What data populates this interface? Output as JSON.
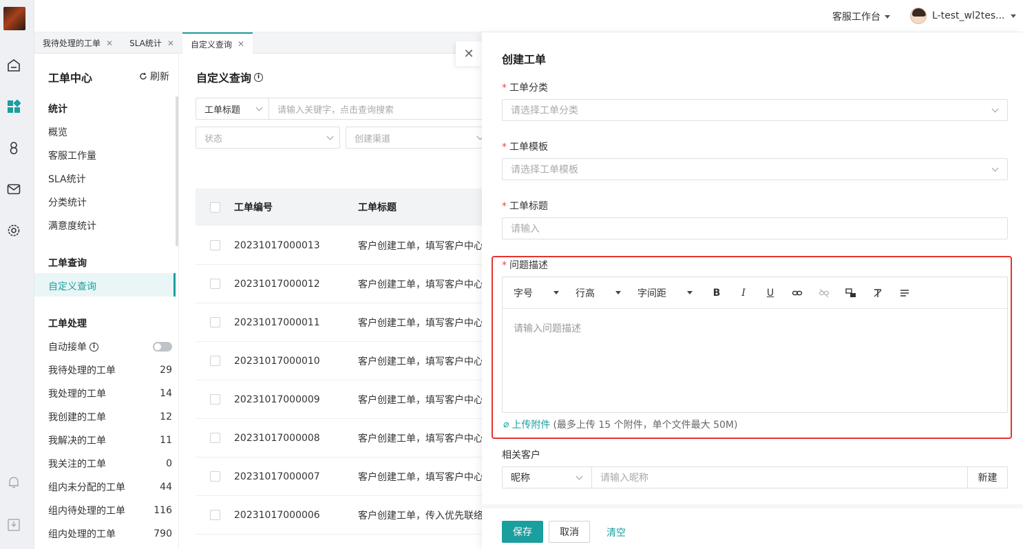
{
  "topbar": {
    "workspace": "客服工作台",
    "username": "L-test_wl2tes..."
  },
  "tabs": [
    {
      "label": "我待处理的工单",
      "active": false
    },
    {
      "label": "SLA统计",
      "active": false
    },
    {
      "label": "自定义查询",
      "active": true
    }
  ],
  "sidenav": {
    "title": "工单中心",
    "refresh": "刷新",
    "sections": {
      "stats": {
        "label": "统计",
        "items": [
          "概览",
          "客服工作量",
          "SLA统计",
          "分类统计",
          "满意度统计"
        ]
      },
      "query": {
        "label": "工单查询",
        "items": [
          "自定义查询"
        ]
      },
      "process": {
        "label": "工单处理",
        "auto_accept": "自动接单",
        "items": [
          {
            "label": "我待处理的工单",
            "count": "29"
          },
          {
            "label": "我处理的工单",
            "count": "14"
          },
          {
            "label": "我创建的工单",
            "count": "12"
          },
          {
            "label": "我解决的工单",
            "count": "11"
          },
          {
            "label": "我关注的工单",
            "count": "0"
          },
          {
            "label": "组内未分配的工单",
            "count": "44"
          },
          {
            "label": "组内待处理的工单",
            "count": "116"
          },
          {
            "label": "组内处理的工单",
            "count": "790"
          }
        ]
      }
    }
  },
  "main": {
    "title": "自定义查询",
    "search_field": "工单标题",
    "search_placeholder": "请输入关键字，点击查询搜索",
    "filter_status": "状态",
    "filter_channel": "创建渠道",
    "columns": [
      "工单编号",
      "工单标题"
    ],
    "rows": [
      {
        "id": "20231017000013",
        "title": "客户创建工单，填写客户中心"
      },
      {
        "id": "20231017000012",
        "title": "客户创建工单，填写客户中心"
      },
      {
        "id": "20231017000011",
        "title": "客户创建工单，填写客户中心"
      },
      {
        "id": "20231017000010",
        "title": "客户创建工单，填写客户中心"
      },
      {
        "id": "20231017000009",
        "title": "客户创建工单，填写客户中心"
      },
      {
        "id": "20231017000008",
        "title": "客户创建工单，填写客户中心"
      },
      {
        "id": "20231017000007",
        "title": "客户创建工单，填写客户中心"
      },
      {
        "id": "20231017000006",
        "title": "客户创建工单，传入优先联络"
      }
    ]
  },
  "drawer": {
    "title": "创建工单",
    "category_label": "工单分类",
    "category_placeholder": "请选择工单分类",
    "template_label": "工单模板",
    "template_placeholder": "请选择工单模板",
    "subject_label": "工单标题",
    "subject_placeholder": "请输入",
    "desc_label": "问题描述",
    "toolbar": {
      "font_size": "字号",
      "line_height": "行高",
      "letter_spacing": "字间距"
    },
    "desc_placeholder": "请输入问题描述",
    "upload_link": "上传附件",
    "upload_hint": "(最多上传 15 个附件，单个文件最大 50M)",
    "customer_label": "相关客户",
    "customer_type": "昵称",
    "customer_placeholder": "请输入昵称",
    "customer_new": "新建",
    "save": "保存",
    "cancel": "取消",
    "clear": "清空"
  },
  "colors": {
    "accent": "#1b9e9e",
    "required": "#e5484d",
    "highlight": "#e5312f"
  }
}
